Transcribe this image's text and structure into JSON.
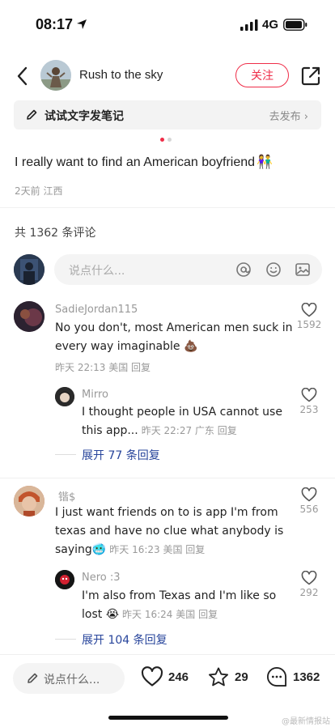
{
  "status_bar": {
    "time": "08:17",
    "network": "4G"
  },
  "header": {
    "author_name": "Rush to the sky",
    "follow_label": "关注"
  },
  "note_bar": {
    "label": "试试文字发笔记",
    "publish": "去发布 ›"
  },
  "post": {
    "text": "I really want to find an American boyfriend",
    "emoji": "👫",
    "meta": "2天前 江西"
  },
  "comments_header": {
    "count_text": "共 1362 条评论"
  },
  "comment_input": {
    "placeholder": "说点什么..."
  },
  "comments": [
    {
      "name": "SadieJordan115",
      "text_line1": "No you don't, most American men suck in",
      "text_line2": "every way imaginable 💩",
      "meta": "昨天 22:13 美国 回复",
      "likes": "1592",
      "replies": [
        {
          "name": "Mirro",
          "text_line1": "I thought people in USA cannot use",
          "text_line2": "this app...",
          "meta": "昨天 22:27 广东 回复",
          "likes": "253"
        }
      ],
      "expand": "展开 77 条回复"
    },
    {
      "name": "锴$",
      "text_line1": "I just want friends on to is app I'm from",
      "text_line2": "texas and have no clue what anybody is",
      "text_line3": "saying🥶",
      "meta": "昨天 16:23 美国 回复",
      "likes": "556",
      "replies": [
        {
          "name": "Nero :3",
          "text_line1": "I'm also from Texas and I'm like so",
          "text_line2": "lost 😭",
          "meta": "昨天 16:24 美国 回复",
          "likes": "292"
        }
      ],
      "expand": "展开 104 条回复"
    }
  ],
  "bottom_bar": {
    "placeholder": "说点什么...",
    "likes": "246",
    "stars": "29",
    "comments": "1362"
  },
  "watermark": "@最新情报站",
  "colors": {
    "accent": "#ef2d48",
    "link": "#27449b",
    "muted": "#999999"
  }
}
